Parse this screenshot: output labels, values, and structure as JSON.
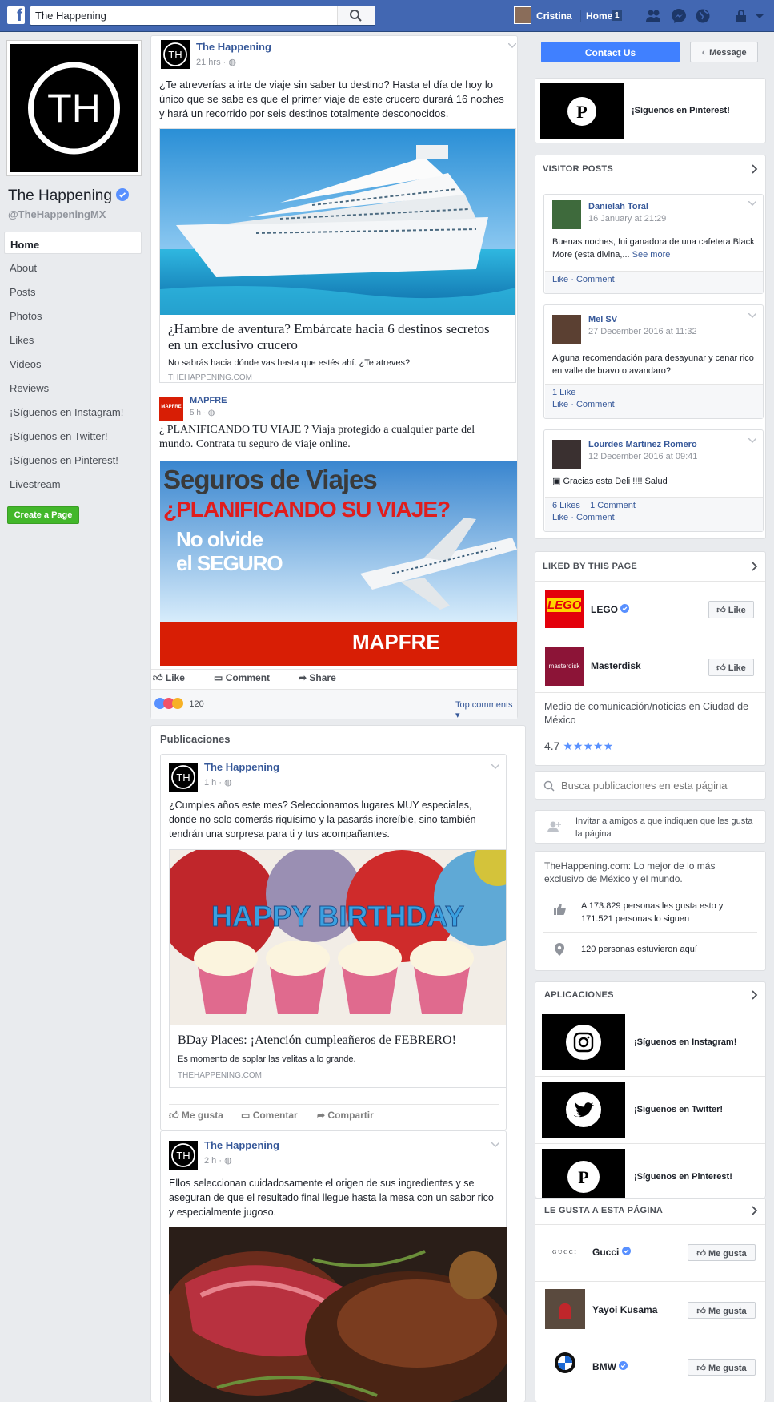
{
  "topbar": {
    "search_value": "The Happening",
    "user_name": "Cristina",
    "home_label": "Home",
    "home_count": "1"
  },
  "left": {
    "page_name": "The Happening",
    "handle": "@TheHappeningMX",
    "nav": [
      "Home",
      "About",
      "Posts",
      "Photos",
      "Likes",
      "Videos",
      "Reviews",
      "¡Síguenos en Instagram!",
      "¡Síguenos en Twitter!",
      "¡Síguenos en Pinterest!",
      "Livestream"
    ],
    "create_page": "Create a Page",
    "logo_text": "TH"
  },
  "post1": {
    "author": "The Happening",
    "time": "21 hrs ·",
    "text": "¿Te atreverías a irte de viaje sin saber tu destino? Hasta el día de hoy lo único que se sabe es que el primer viaje de este crucero durará 16 noches y hará un recorrido por seis destinos totalmente desconocidos.",
    "link_title": "¿Hambre de aventura? Embárcate hacia 6 destinos secretos en un exclusivo crucero",
    "link_desc": "No sabrás hacia dónde vas hasta que estés ahí. ¿Te atreves?",
    "link_domain": "THEHAPPENING.COM"
  },
  "ad": {
    "author": "MAPFRE",
    "time": "5 h ·",
    "text": "¿ PLANIFICANDO TU VIAJE ? Viaja protegido a cualquier parte del mundo. Contrata tu seguro de viaje online.",
    "banner_line1": "Seguros de Viajes",
    "banner_line2": "¿PLANIFICANDO SU VIAJE?",
    "banner_line3": "No olvide",
    "banner_line4": "el SEGURO",
    "brand": "MAPFRE",
    "like": "Like",
    "comment": "Comment",
    "share": "Share",
    "reactions_count": "120",
    "top_comments": "Top comments"
  },
  "publicaciones": {
    "title": "Publicaciones",
    "post2": {
      "author": "The Happening",
      "time": "1 h ·",
      "text": "¿Cumples años este mes? Seleccionamos lugares MUY especiales, donde no solo comerás riquísimo y la pasarás increíble, sino también tendrán una sorpresa para ti y tus acompañantes.",
      "image_text": "HAPPY BIRTHDAY",
      "link_title": "BDay Places: ¡Atención cumpleañeros de FEBRERO!",
      "link_desc": "Es momento de soplar las velitas a lo grande.",
      "link_domain": "THEHAPPENING.COM",
      "me_gusta": "Me gusta",
      "comentar": "Comentar",
      "compartir": "Compartir"
    },
    "post3": {
      "author": "The Happening",
      "time": "2 h ·",
      "text": "Ellos seleccionan cuidadosamente el origen de sus ingredientes y se aseguran de que el resultado final llegue hasta la mesa con un sabor rico y especialmente jugoso."
    }
  },
  "right": {
    "contact_us": "Contact Us",
    "message": "Message",
    "pinterest_top": "¡Síguenos en Pinterest!",
    "visitor_posts_title": "VISITOR POSTS",
    "visitor_posts": [
      {
        "name": "Danielah Toral",
        "date": "16 January at 21:29",
        "text": "Buenas noches, fui ganadora de una cafetera Black More (esta divina,...",
        "see_more": "See more",
        "likes": "",
        "comments": "",
        "actions": "Like · Comment"
      },
      {
        "name": "Mel SV",
        "date": "27 December 2016 at 11:32",
        "text": "Alguna recomendación para desayunar y cenar rico en valle de bravo o avandaro?",
        "likes": "1 Like",
        "comments": "",
        "actions": "Like · Comment"
      },
      {
        "name": "Lourdes Martinez Romero",
        "date": "12 December 2016 at 09:41",
        "text": "Gracias esta Deli !!!! Salud",
        "likes": "6 Likes",
        "comments": "1 Comment",
        "actions": "Like · Comment"
      }
    ],
    "liked_title": "LIKED BY THIS PAGE",
    "liked": [
      {
        "name": "LEGO",
        "logo": "LEGO",
        "button": "Like"
      },
      {
        "name": "Masterdisk",
        "logo": "masterdisk",
        "button": "Like"
      }
    ],
    "about_category": "Medio de comunicación/noticias en Ciudad de México",
    "rating": "4.7",
    "search_placeholder": "Busca publicaciones en esta página",
    "invite_text": "Invitar a amigos a que indiquen que les gusta la página",
    "description": "TheHappening.com: Lo mejor de lo más exclusivo de México y el mundo.",
    "likes_text": "A 173.829 personas les gusta esto y 171.521 personas lo siguen",
    "checkins_text": "120 personas estuvieron aquí",
    "apps_title": "APLICACIONES",
    "apps": [
      "¡Síguenos en Instagram!",
      "¡Síguenos en Twitter!",
      "¡Síguenos en Pinterest!"
    ],
    "le_gusta_title": "LE GUSTA A ESTA PÁGINA",
    "le_gusta": [
      {
        "name": "Gucci",
        "logo": "GUCCI",
        "button": "Me gusta"
      },
      {
        "name": "Yayoi Kusama",
        "logo": "",
        "button": "Me gusta"
      },
      {
        "name": "BMW",
        "logo": "",
        "button": "Me gusta"
      }
    ]
  },
  "colors": {
    "fb_blue": "#4267b2",
    "link": "#365899",
    "green": "#42b72a",
    "mapfre_red": "#d81e05"
  }
}
